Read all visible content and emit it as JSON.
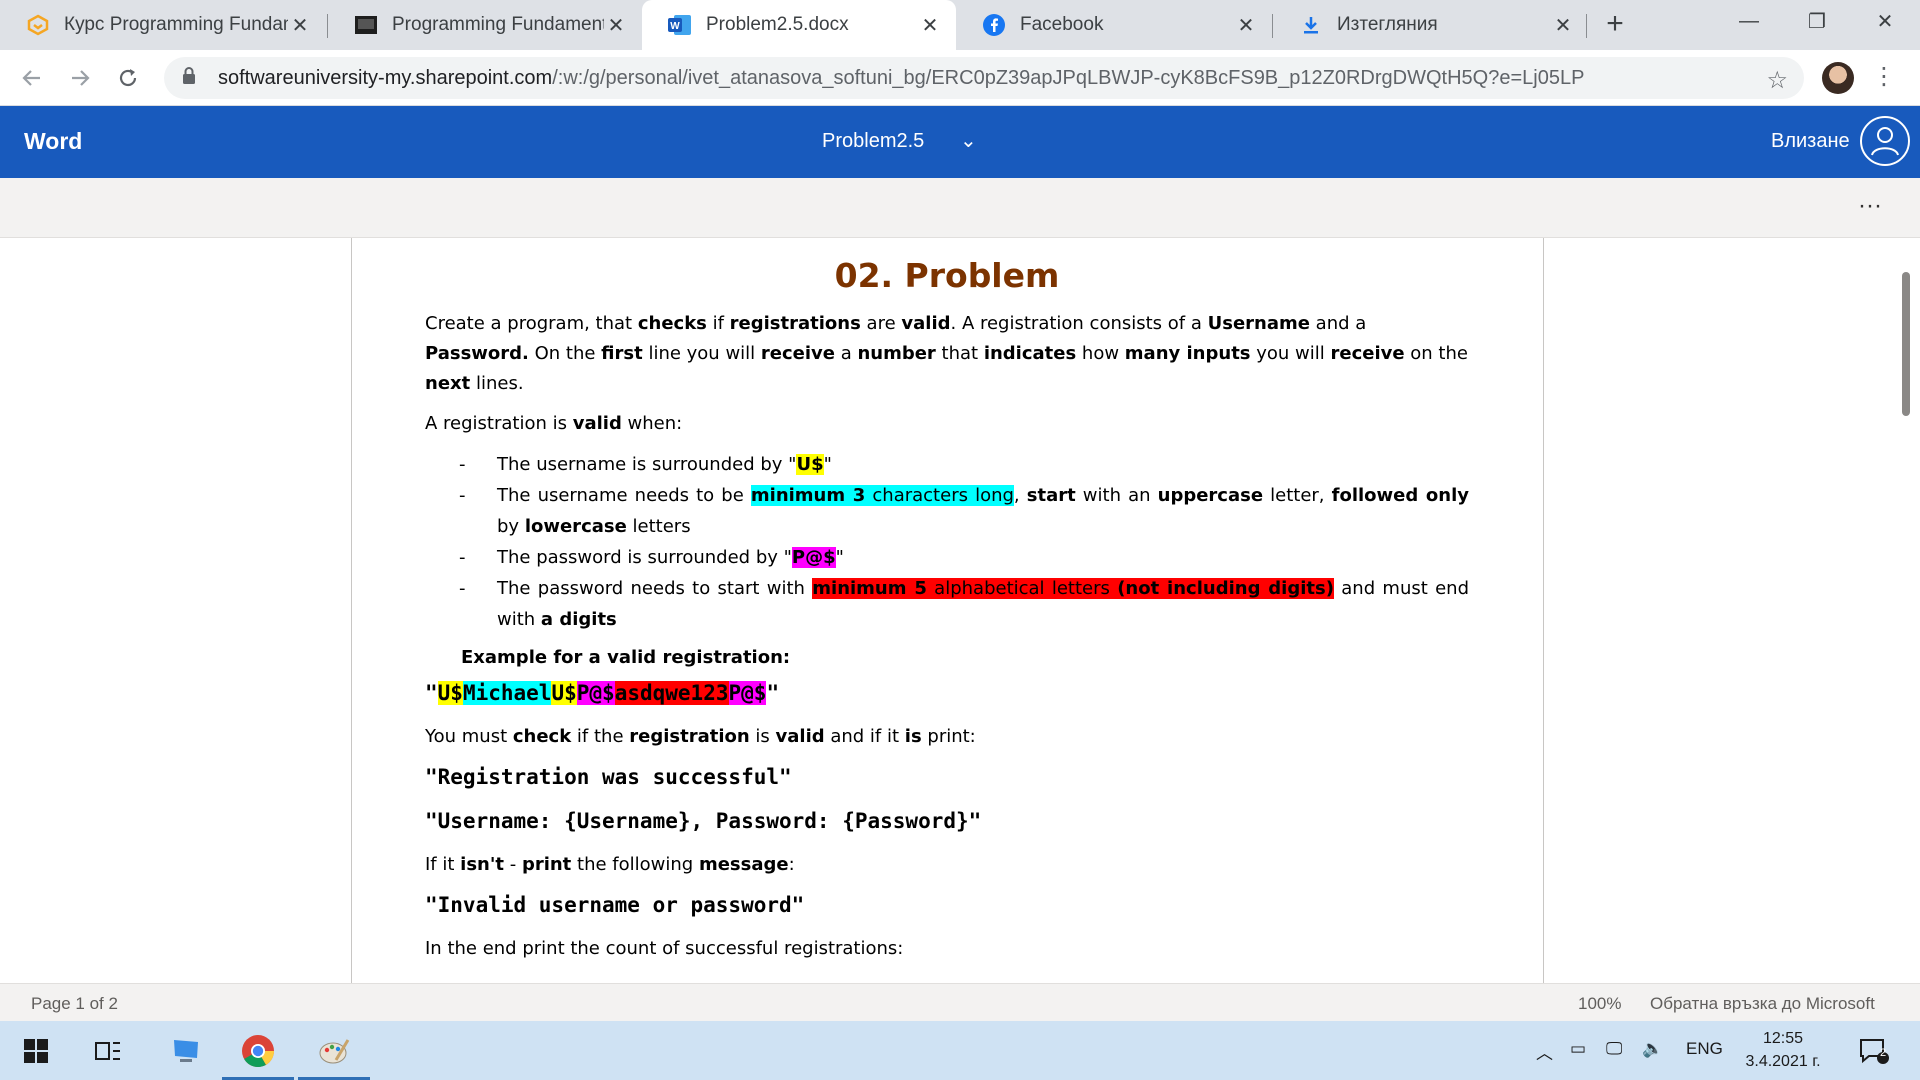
{
  "browser": {
    "tabs": [
      {
        "title": "Курс Programming Fundamentals",
        "icon": "softuni-icon",
        "active": false
      },
      {
        "title": "Programming Fundamentals",
        "icon": "video-icon",
        "active": false
      },
      {
        "title": "Problem2.5.docx",
        "icon": "word-icon",
        "active": true
      },
      {
        "title": "Facebook",
        "icon": "facebook-icon",
        "active": false
      },
      {
        "title": "Изтегляния",
        "icon": "download-icon",
        "active": false
      }
    ],
    "address": {
      "host": "softwareuniversity-my.sharepoint.com",
      "path": "/:w:/g/personal/ivet_atanasova_softuni_bg/ERC0pZ39apJPqLBWJP-cyK8BcFS9B_p12Z0RDrgDWQtH5Q?e=Lj05LP"
    }
  },
  "word": {
    "brand": "Word",
    "doc_title": "Problem2.5",
    "signin": "Влизане"
  },
  "doc": {
    "heading": "02. Problem",
    "p1": {
      "t1": "Create a program, that ",
      "b1": "checks",
      "t2": " if ",
      "b2": "registrations",
      "t3": " are ",
      "b3": "valid",
      "t4": ". A registration consists of a ",
      "b4": "Username",
      "t5": " and a ",
      "b5": "Password.",
      "t6": " On the ",
      "b6": "first",
      "t7": " line you will ",
      "b7": "receive",
      "t8": " a ",
      "b8": "number",
      "t9": " that ",
      "b9": "indicates",
      "t10": " how ",
      "b10": "many inputs",
      "t11": " you will ",
      "b11": "receive",
      "t12": " on the ",
      "b12": "next",
      "t13": " lines."
    },
    "p2": {
      "t1": "A registration is ",
      "b1": "valid",
      "t2": " when:"
    },
    "list": {
      "dash": "-",
      "i1": {
        "t1": "The username is surrounded by \"",
        "h1": "U$",
        "t2": "\""
      },
      "i2": {
        "t1": "The username needs to be ",
        "h1": "minimum 3",
        "h2": " characters long",
        "t2": ", ",
        "b1": "start",
        "t3": " with an ",
        "b2": "uppercase",
        "t4": " letter, ",
        "b3": "followed only",
        "t5": " by ",
        "b4": "lowercase",
        "t6": " letters"
      },
      "i3": {
        "t1": "The password is surrounded by \"",
        "h1": "P@$",
        "t2": "\""
      },
      "i4": {
        "t1": "The password needs to start with ",
        "h1": "minimum 5",
        "h2": " alphabetical letters ",
        "h3": "(not including digits)",
        "t2": " and must end with ",
        "b1": "a digits"
      }
    },
    "example_heading": "Example for a valid registration:",
    "example": {
      "q1": "\"",
      "s1": "U$",
      "s2": "Michael",
      "s3": "U$",
      "s4": "P@$",
      "s5": "asdqwe123",
      "s6": "P@$",
      "q2": "\""
    },
    "p3": {
      "t1": "You must ",
      "b1": "check",
      "t2": " if the ",
      "b2": "registration",
      "t3": " is ",
      "b3": "valid",
      "t4": " and if it ",
      "b4": "is",
      "t5": " print:"
    },
    "msg_success": "\"Registration was successful\"",
    "msg_user": "\"Username: {Username}, Password: {Password}\"",
    "p4": {
      "t1": "If it ",
      "b1": "isn't",
      "t2": " - ",
      "b2": "print",
      "t3": " the following ",
      "b3": "message",
      "t4": ":"
    },
    "msg_invalid": "\"Invalid username or password\"",
    "p5": "In the end print the count of successful registrations:"
  },
  "status": {
    "page": "Page 1 of 2",
    "zoom": "100%",
    "feedback": "Обратна връзка до Microsoft"
  },
  "taskbar": {
    "lang": "ENG",
    "time": "12:55",
    "date": "3.4.2021 г.",
    "notifications": "2"
  },
  "colors": {
    "word_blue": "#185abd",
    "heading_brown": "#7c3300"
  }
}
